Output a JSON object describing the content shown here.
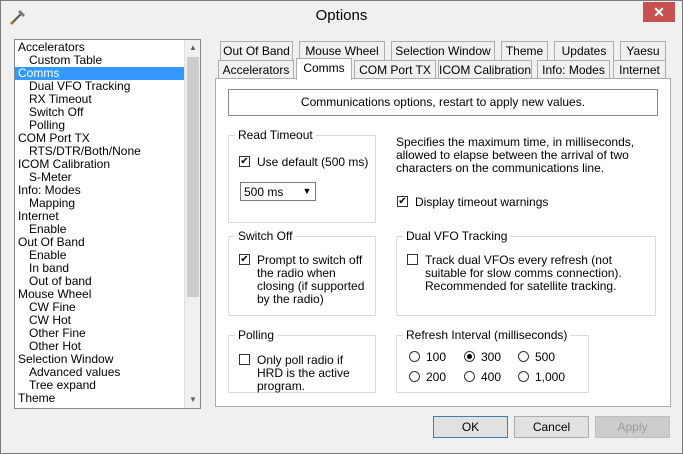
{
  "window": {
    "title": "Options",
    "close_label": "✕"
  },
  "tree": {
    "items": [
      {
        "label": "Accelerators",
        "level": 0
      },
      {
        "label": "Custom Table",
        "level": 1
      },
      {
        "label": "Comms",
        "level": 0,
        "selected": true
      },
      {
        "label": "Dual VFO Tracking",
        "level": 1
      },
      {
        "label": "RX Timeout",
        "level": 1
      },
      {
        "label": "Switch Off",
        "level": 1
      },
      {
        "label": "Polling",
        "level": 1
      },
      {
        "label": "COM Port TX",
        "level": 0
      },
      {
        "label": "RTS/DTR/Both/None",
        "level": 1
      },
      {
        "label": "ICOM Calibration",
        "level": 0
      },
      {
        "label": "S-Meter",
        "level": 1
      },
      {
        "label": "Info: Modes",
        "level": 0
      },
      {
        "label": "Mapping",
        "level": 1
      },
      {
        "label": "Internet",
        "level": 0
      },
      {
        "label": "Enable",
        "level": 1
      },
      {
        "label": "Out Of Band",
        "level": 0
      },
      {
        "label": "Enable",
        "level": 1
      },
      {
        "label": "In band",
        "level": 1
      },
      {
        "label": "Out of band",
        "level": 1
      },
      {
        "label": "Mouse Wheel",
        "level": 0
      },
      {
        "label": "CW Fine",
        "level": 1
      },
      {
        "label": "CW Hot",
        "level": 1
      },
      {
        "label": "Other Fine",
        "level": 1
      },
      {
        "label": "Other Hot",
        "level": 1
      },
      {
        "label": "Selection Window",
        "level": 0
      },
      {
        "label": "Advanced values",
        "level": 1
      },
      {
        "label": "Tree expand",
        "level": 1
      },
      {
        "label": "Theme",
        "level": 0
      }
    ]
  },
  "tabs_row1": [
    "Out Of Band",
    "Mouse Wheel",
    "Selection Window",
    "Theme",
    "Updates",
    "Yaesu"
  ],
  "tabs_row2": [
    "Accelerators",
    "Comms",
    "COM Port TX",
    "ICOM Calibration",
    "Info: Modes",
    "Internet"
  ],
  "active_tab": "Comms",
  "panel": {
    "info": "Communications options, restart to apply new values.",
    "read_timeout": {
      "legend": "Read Timeout",
      "use_default_label": "Use default (500 ms)",
      "use_default_checked": true,
      "select_value": "500 ms"
    },
    "timeout_desc": "Specifies the maximum time, in milliseconds, allowed to elapse between the arrival of two characters on the communications line.",
    "display_warnings_label": "Display timeout warnings",
    "display_warnings_checked": true,
    "switch_off": {
      "legend": "Switch Off",
      "label": "Prompt to switch off the radio when closing (if supported by the radio)",
      "checked": true
    },
    "dual_vfo": {
      "legend": "Dual VFO Tracking",
      "label": "Track dual VFOs every refresh (not suitable for slow comms connection). Recommended for satellite tracking.",
      "checked": false
    },
    "polling": {
      "legend": "Polling",
      "label": "Only poll radio if HRD is the active program.",
      "checked": false
    },
    "refresh": {
      "legend": "Refresh Interval (milliseconds)",
      "options": [
        "100",
        "300",
        "500",
        "200",
        "400",
        "1,000"
      ],
      "selected": "300"
    }
  },
  "buttons": {
    "ok": "OK",
    "cancel": "Cancel",
    "apply": "Apply"
  }
}
